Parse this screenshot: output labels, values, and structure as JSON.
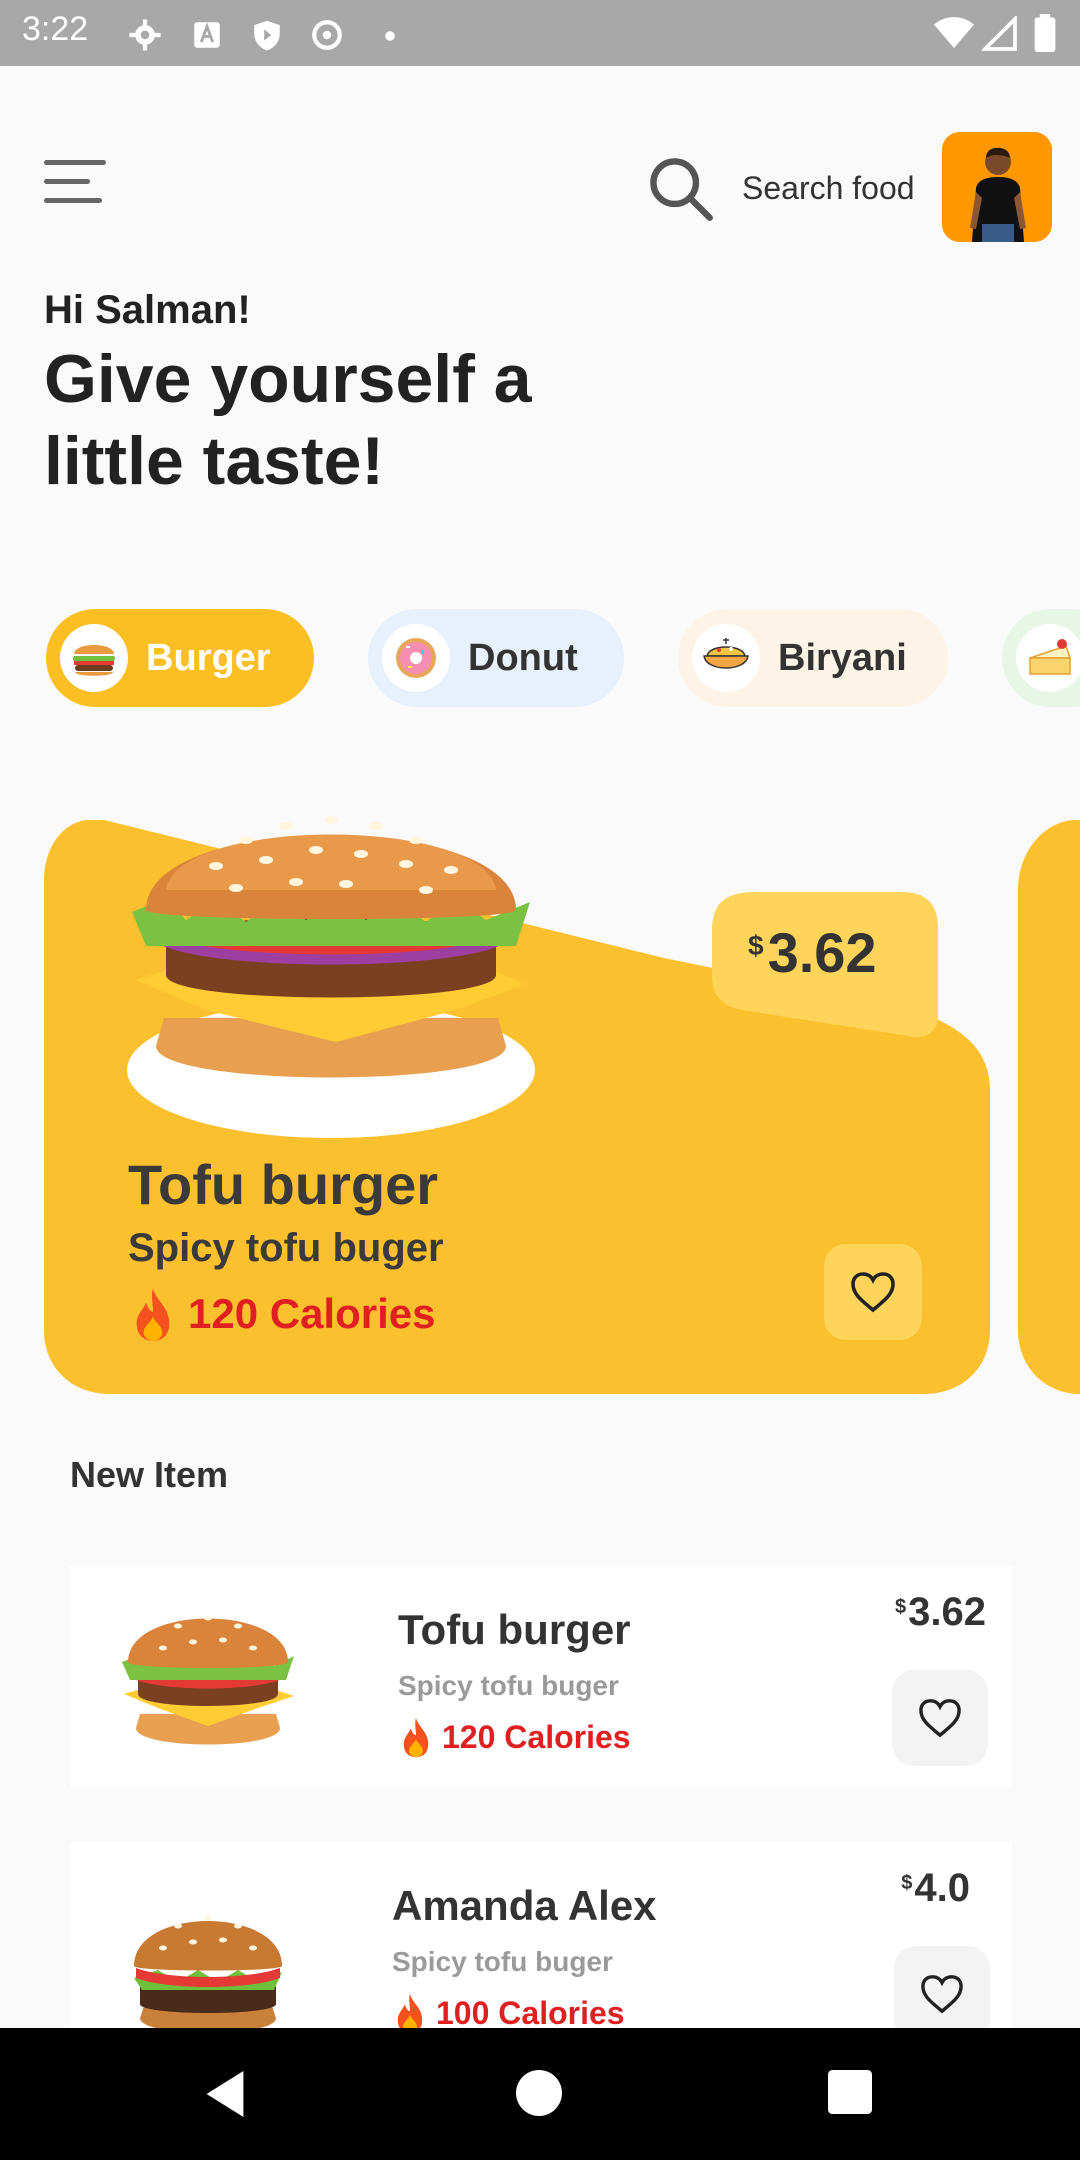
{
  "status_bar": {
    "time": "3:22"
  },
  "header": {
    "search_label": "Search food"
  },
  "greeting": {
    "hello": "Hi Salman!",
    "headline": "Give yourself a little taste!"
  },
  "categories": [
    {
      "label": "Burger",
      "icon": "burger-icon",
      "selected": true
    },
    {
      "label": "Donut",
      "icon": "donut-icon",
      "selected": false
    },
    {
      "label": "Biryani",
      "icon": "biryani-icon",
      "selected": false
    },
    {
      "label": "",
      "icon": "cake-icon",
      "selected": false
    }
  ],
  "featured": {
    "currency": "$",
    "price": "3.62",
    "title": "Tofu burger",
    "subtitle": "Spicy tofu buger",
    "calories": "120 Calories"
  },
  "new_items": {
    "section_title": "New Item",
    "items": [
      {
        "title": "Tofu burger",
        "subtitle": "Spicy tofu buger",
        "calories": "120 Calories",
        "currency": "$",
        "price": "3.62"
      },
      {
        "title": "Amanda Alex",
        "subtitle": "Spicy tofu buger",
        "calories": "100 Calories",
        "currency": "$",
        "price": "4.0"
      }
    ]
  },
  "colors": {
    "accent": "#fbc02d",
    "calories": "#e02020",
    "avatar_bg": "#ff9800"
  }
}
